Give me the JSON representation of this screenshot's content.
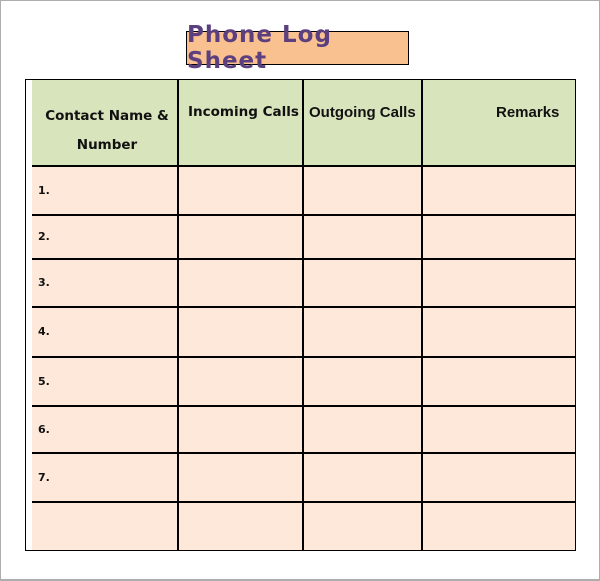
{
  "document": {
    "title": "Phone Log Sheet",
    "colors": {
      "title_bg": "#fac190",
      "title_text": "#5b3f7f",
      "header_bg": "#d8e4bc",
      "row_bg": "#fde8d9"
    }
  },
  "table": {
    "headers": {
      "contact_line1": "Contact Name &",
      "contact_line2": "Number",
      "incoming": "Incoming Calls",
      "outgoing": "Outgoing Calls",
      "remarks": "Remarks"
    },
    "rows": [
      {
        "num": "1.",
        "incoming": "",
        "outgoing": "",
        "remarks": ""
      },
      {
        "num": "2.",
        "incoming": "",
        "outgoing": "",
        "remarks": ""
      },
      {
        "num": "3.",
        "incoming": "",
        "outgoing": "",
        "remarks": ""
      },
      {
        "num": "4.",
        "incoming": "",
        "outgoing": "",
        "remarks": ""
      },
      {
        "num": "5.",
        "incoming": "",
        "outgoing": "",
        "remarks": ""
      },
      {
        "num": "6.",
        "incoming": "",
        "outgoing": "",
        "remarks": ""
      },
      {
        "num": "7.",
        "incoming": "",
        "outgoing": "",
        "remarks": ""
      },
      {
        "num": "",
        "incoming": "",
        "outgoing": "",
        "remarks": ""
      }
    ]
  }
}
